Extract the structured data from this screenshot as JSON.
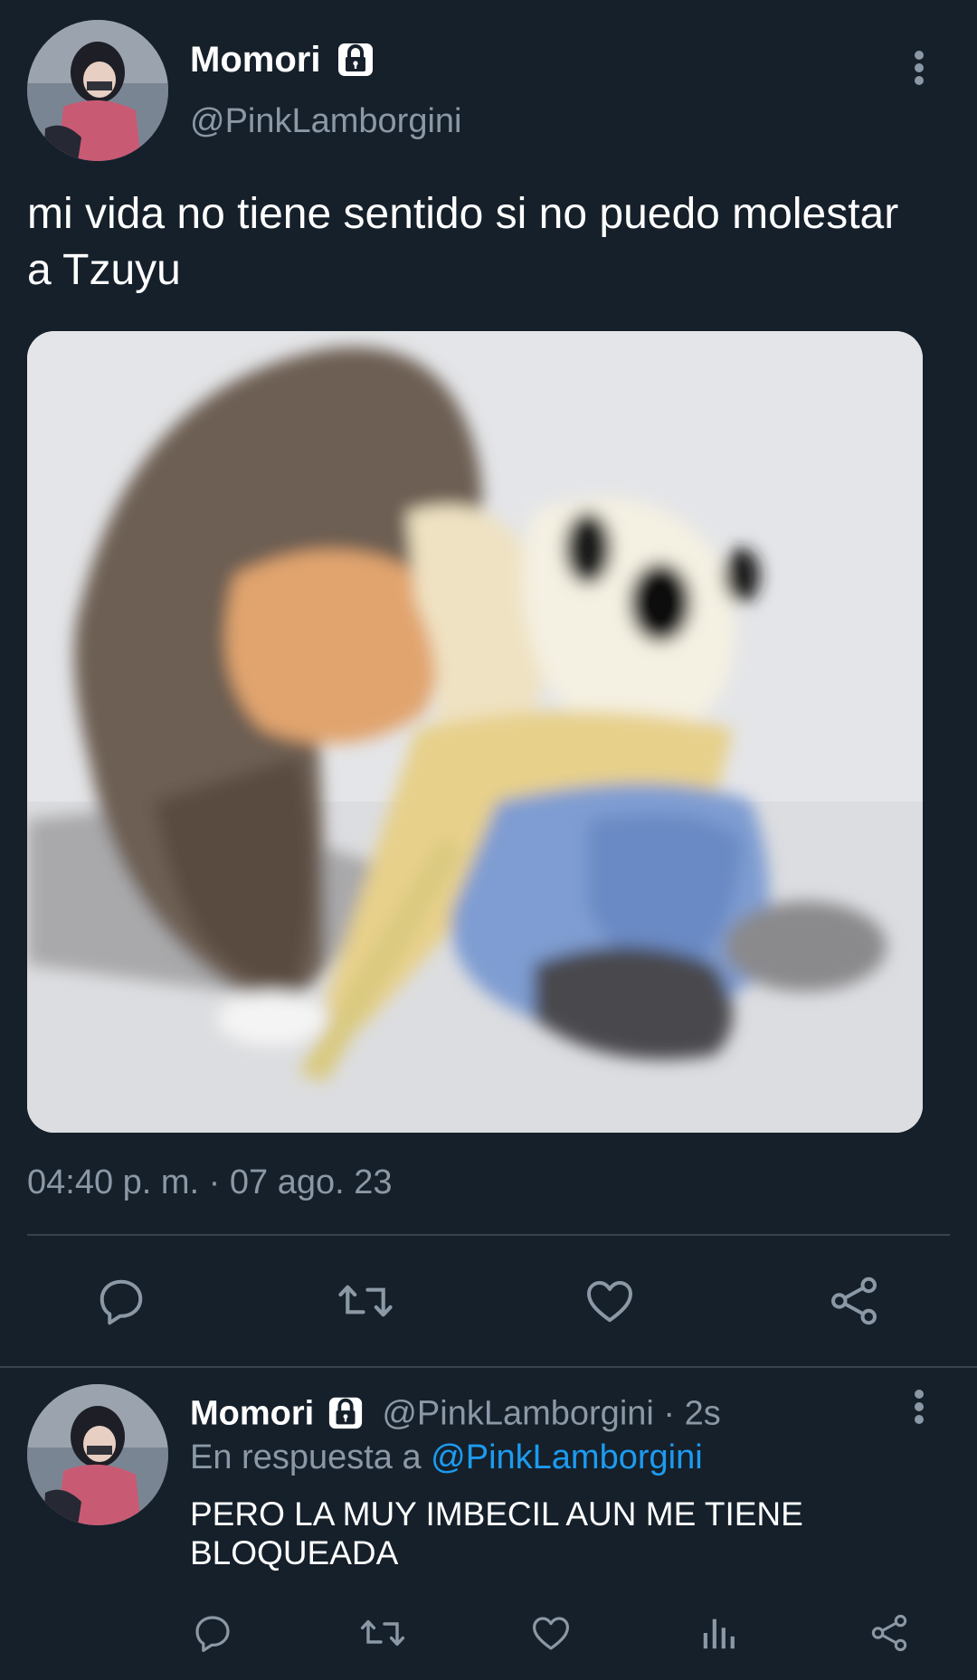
{
  "tweet": {
    "author": {
      "display_name": "Momori",
      "handle": "@PinkLamborgini",
      "protected_icon": "lock-icon",
      "avatar_icon": "avatar"
    },
    "text": "mi vida no tiene sentido si no puedo molestar a Tzuyu",
    "timestamp": "04:40 p. m. · 07 ago. 23",
    "media_icon": "attached-image",
    "actions": [
      "reply-icon",
      "retweet-icon",
      "like-icon",
      "share-icon"
    ]
  },
  "reply": {
    "author": {
      "display_name": "Momori",
      "handle": "@PinkLamborgini",
      "time": "2s"
    },
    "separator": "·",
    "replying_to_prefix": "En respuesta a",
    "replying_to_handle": "@PinkLamborgini",
    "text": "PERO LA MUY IMBECIL AUN ME TIENE BLOQUEADA",
    "actions": [
      "reply-icon",
      "retweet-icon",
      "like-icon",
      "analytics-icon",
      "share-icon"
    ]
  },
  "colors": {
    "background": "#15202b",
    "secondary_text": "#8b98a5",
    "link": "#1d9bf0",
    "divider": "#38444d"
  }
}
